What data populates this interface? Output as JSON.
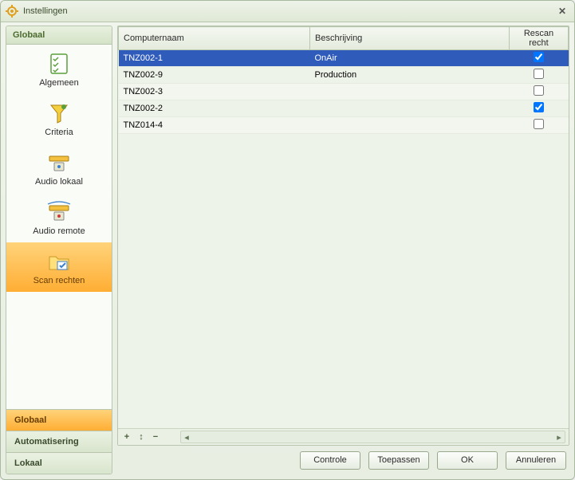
{
  "window": {
    "title": "Instellingen"
  },
  "sidebar": {
    "header": "Globaal",
    "items": [
      {
        "label": "Algemeen"
      },
      {
        "label": "Criteria"
      },
      {
        "label": "Audio lokaal"
      },
      {
        "label": "Audio remote"
      },
      {
        "label": "Scan rechten"
      }
    ],
    "footer": [
      {
        "label": "Globaal"
      },
      {
        "label": "Automatisering"
      },
      {
        "label": "Lokaal"
      }
    ]
  },
  "table": {
    "columns": {
      "name": "Computernaam",
      "desc": "Beschrijving",
      "chk": "Rescan recht"
    },
    "rows": [
      {
        "name": "TNZ002-1",
        "desc": "OnAir",
        "checked": true
      },
      {
        "name": "TNZ002-9",
        "desc": "Production",
        "checked": false
      },
      {
        "name": "TNZ002-3",
        "desc": "",
        "checked": false
      },
      {
        "name": "TNZ002-2",
        "desc": "",
        "checked": true
      },
      {
        "name": "TNZ014-4",
        "desc": "",
        "checked": false
      }
    ]
  },
  "tools": {
    "add": "+",
    "move": "↕",
    "remove": "−"
  },
  "buttons": {
    "controle": "Controle",
    "toepassen": "Toepassen",
    "ok": "OK",
    "annuleren": "Annuleren"
  }
}
